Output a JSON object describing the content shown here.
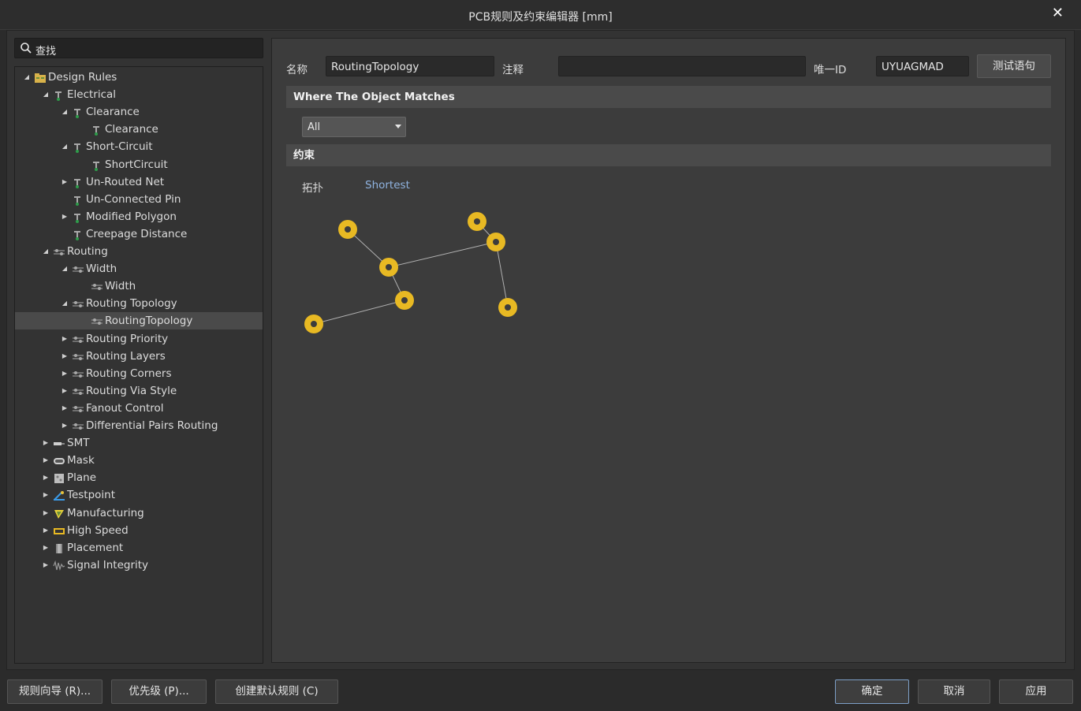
{
  "window": {
    "title": "PCB规则及约束编辑器 [mm]",
    "close_glyph": "✕"
  },
  "search": {
    "placeholder": "查找"
  },
  "tree": [
    {
      "label": "Design Rules",
      "icon": "folder-icon",
      "arrow": "expanded",
      "level": 0,
      "selected": false
    },
    {
      "label": "Electrical",
      "icon": "electrical-rule-icon",
      "arrow": "expanded",
      "level": 1,
      "selected": false
    },
    {
      "label": "Clearance",
      "icon": "electrical-rule-icon",
      "arrow": "expanded",
      "level": 2,
      "selected": false
    },
    {
      "label": "Clearance",
      "icon": "electrical-rule-icon",
      "arrow": "none",
      "level": 3,
      "selected": false
    },
    {
      "label": "Short-Circuit",
      "icon": "electrical-rule-icon",
      "arrow": "expanded",
      "level": 2,
      "selected": false
    },
    {
      "label": "ShortCircuit",
      "icon": "electrical-rule-icon",
      "arrow": "none",
      "level": 3,
      "selected": false
    },
    {
      "label": "Un-Routed Net",
      "icon": "electrical-rule-icon",
      "arrow": "collapsed",
      "level": 2,
      "selected": false
    },
    {
      "label": "Un-Connected Pin",
      "icon": "electrical-rule-icon",
      "arrow": "none",
      "level": 2,
      "selected": false
    },
    {
      "label": "Modified Polygon",
      "icon": "electrical-rule-icon",
      "arrow": "collapsed",
      "level": 2,
      "selected": false
    },
    {
      "label": "Creepage Distance",
      "icon": "electrical-rule-icon",
      "arrow": "none",
      "level": 2,
      "selected": false
    },
    {
      "label": "Routing",
      "icon": "routing-rule-icon",
      "arrow": "expanded",
      "level": 1,
      "selected": false
    },
    {
      "label": "Width",
      "icon": "routing-rule-icon",
      "arrow": "expanded",
      "level": 2,
      "selected": false
    },
    {
      "label": "Width",
      "icon": "routing-rule-icon",
      "arrow": "none",
      "level": 3,
      "selected": false
    },
    {
      "label": "Routing Topology",
      "icon": "routing-rule-icon",
      "arrow": "expanded",
      "level": 2,
      "selected": false
    },
    {
      "label": "RoutingTopology",
      "icon": "routing-rule-icon",
      "arrow": "none",
      "level": 3,
      "selected": true
    },
    {
      "label": "Routing Priority",
      "icon": "routing-rule-icon",
      "arrow": "collapsed",
      "level": 2,
      "selected": false
    },
    {
      "label": "Routing Layers",
      "icon": "routing-rule-icon",
      "arrow": "collapsed",
      "level": 2,
      "selected": false
    },
    {
      "label": "Routing Corners",
      "icon": "routing-rule-icon",
      "arrow": "collapsed",
      "level": 2,
      "selected": false
    },
    {
      "label": "Routing Via Style",
      "icon": "routing-rule-icon",
      "arrow": "collapsed",
      "level": 2,
      "selected": false
    },
    {
      "label": "Fanout Control",
      "icon": "routing-rule-icon",
      "arrow": "collapsed",
      "level": 2,
      "selected": false
    },
    {
      "label": "Differential Pairs Routing",
      "icon": "routing-rule-icon",
      "arrow": "collapsed",
      "level": 2,
      "selected": false
    },
    {
      "label": "SMT",
      "icon": "smt-icon",
      "arrow": "collapsed",
      "level": 1,
      "selected": false
    },
    {
      "label": "Mask",
      "icon": "mask-icon",
      "arrow": "collapsed",
      "level": 1,
      "selected": false
    },
    {
      "label": "Plane",
      "icon": "plane-icon",
      "arrow": "collapsed",
      "level": 1,
      "selected": false
    },
    {
      "label": "Testpoint",
      "icon": "testpoint-icon",
      "arrow": "collapsed",
      "level": 1,
      "selected": false
    },
    {
      "label": "Manufacturing",
      "icon": "manufacturing-icon",
      "arrow": "collapsed",
      "level": 1,
      "selected": false
    },
    {
      "label": "High Speed",
      "icon": "high-speed-icon",
      "arrow": "collapsed",
      "level": 1,
      "selected": false
    },
    {
      "label": "Placement",
      "icon": "placement-icon",
      "arrow": "collapsed",
      "level": 1,
      "selected": false
    },
    {
      "label": "Signal Integrity",
      "icon": "signal-integrity-icon",
      "arrow": "collapsed",
      "level": 1,
      "selected": false
    }
  ],
  "rule": {
    "name_label": "名称",
    "name_value": "RoutingTopology",
    "comment_label": "注释",
    "comment_value": "",
    "uid_label": "唯一ID",
    "uid_value": "UYUAGMAD",
    "test_button": "测试语句"
  },
  "where_section": {
    "title": "Where The Object Matches",
    "dropdown_value": "All"
  },
  "constraints_section": {
    "title": "约束",
    "topology_label": "拓扑",
    "topology_value": "Shortest"
  },
  "colors": {
    "pad": "#e8b923",
    "pad_hole": "#3c3c3c",
    "track": "#b0b0b0",
    "link": "#8fb3e0",
    "selection": "#4a4a4a"
  },
  "buttons": {
    "rule_wizard": "规则向导 (R)...",
    "priority": "优先级 (P)...",
    "create_default": "创建默认规则 (C)",
    "ok": "确定",
    "cancel": "取消",
    "apply": "应用"
  }
}
